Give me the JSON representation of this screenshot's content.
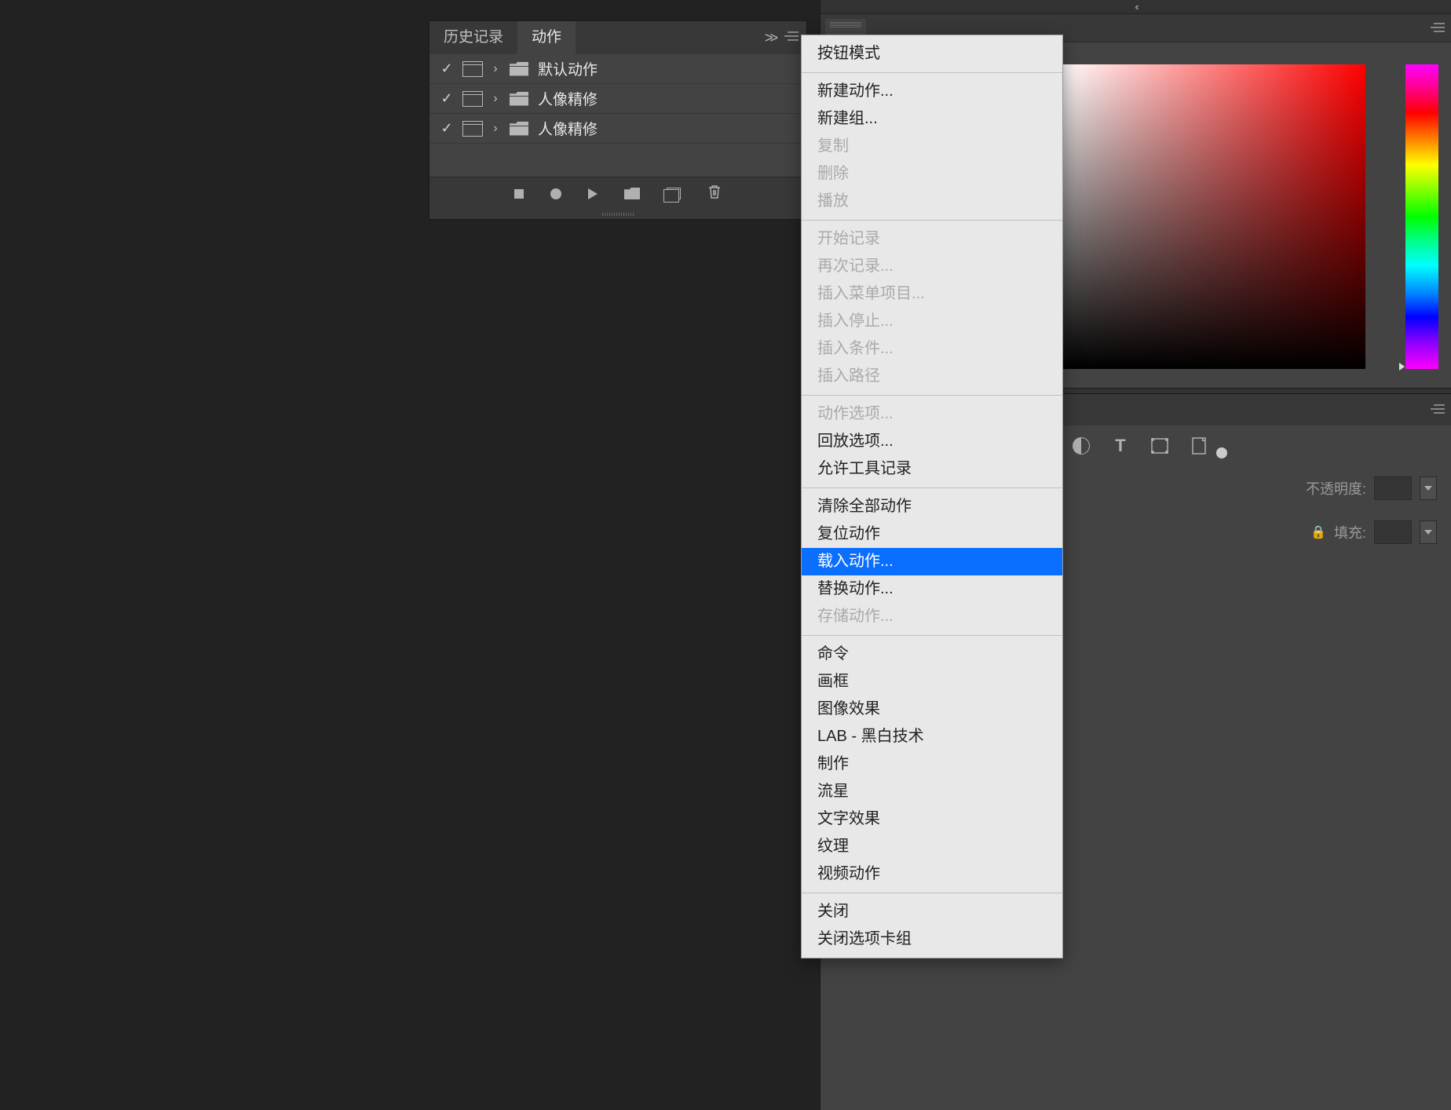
{
  "actions_panel": {
    "tabs": {
      "history": "历史记录",
      "actions": "动作"
    },
    "rows": [
      {
        "name": "默认动作"
      },
      {
        "name": "人像精修"
      },
      {
        "name": "人像精修"
      }
    ]
  },
  "layers_panel": {
    "opacity_label": "不透明度:",
    "fill_label": "填充:"
  },
  "context_menu": {
    "groups": [
      [
        {
          "label": "按钮模式",
          "enabled": true
        }
      ],
      [
        {
          "label": "新建动作...",
          "enabled": true
        },
        {
          "label": "新建组...",
          "enabled": true
        },
        {
          "label": "复制",
          "enabled": false
        },
        {
          "label": "删除",
          "enabled": false
        },
        {
          "label": "播放",
          "enabled": false
        }
      ],
      [
        {
          "label": "开始记录",
          "enabled": false
        },
        {
          "label": "再次记录...",
          "enabled": false
        },
        {
          "label": "插入菜单项目...",
          "enabled": false
        },
        {
          "label": "插入停止...",
          "enabled": false
        },
        {
          "label": "插入条件...",
          "enabled": false
        },
        {
          "label": "插入路径",
          "enabled": false
        }
      ],
      [
        {
          "label": "动作选项...",
          "enabled": false
        },
        {
          "label": "回放选项...",
          "enabled": true
        },
        {
          "label": "允许工具记录",
          "enabled": true
        }
      ],
      [
        {
          "label": "清除全部动作",
          "enabled": true
        },
        {
          "label": "复位动作",
          "enabled": true
        },
        {
          "label": "载入动作...",
          "enabled": true,
          "highlighted": true
        },
        {
          "label": "替换动作...",
          "enabled": true
        },
        {
          "label": "存储动作...",
          "enabled": false
        }
      ],
      [
        {
          "label": "命令",
          "enabled": true
        },
        {
          "label": "画框",
          "enabled": true
        },
        {
          "label": "图像效果",
          "enabled": true
        },
        {
          "label": "LAB - 黑白技术",
          "enabled": true
        },
        {
          "label": "制作",
          "enabled": true
        },
        {
          "label": "流星",
          "enabled": true
        },
        {
          "label": "文字效果",
          "enabled": true
        },
        {
          "label": "纹理",
          "enabled": true
        },
        {
          "label": "视频动作",
          "enabled": true
        }
      ],
      [
        {
          "label": "关闭",
          "enabled": true
        },
        {
          "label": "关闭选项卡组",
          "enabled": true
        }
      ]
    ]
  }
}
